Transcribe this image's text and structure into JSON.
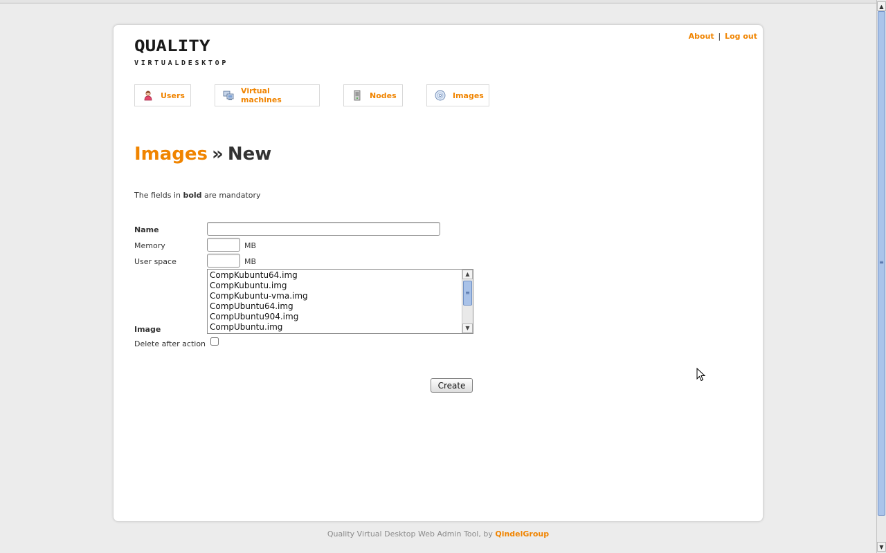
{
  "header": {
    "logo_main": "QUALITY",
    "logo_sub": "VIRTUALDESKTOP",
    "about_link": "About",
    "separator": "|",
    "logout_link": "Log out"
  },
  "nav": [
    {
      "label": "Users",
      "icon": "user-icon"
    },
    {
      "label": "Virtual machines",
      "icon": "virtual-machines-icon"
    },
    {
      "label": "Nodes",
      "icon": "server-icon"
    },
    {
      "label": "Images",
      "icon": "disc-icon"
    }
  ],
  "page": {
    "section": "Images",
    "separator": "»",
    "current": "New"
  },
  "hint": {
    "before": "The fields in ",
    "bold": "bold",
    "after": " are mandatory"
  },
  "form": {
    "name_label": "Name",
    "name_value": "",
    "memory_label": "Memory",
    "memory_value": "",
    "memory_unit": "MB",
    "user_space_label": "User space",
    "user_space_value": "",
    "user_space_unit": "MB",
    "image_label": "Image",
    "image_options": [
      "CompKubuntu64.img",
      "CompKubuntu.img",
      "CompKubuntu-vma.img",
      "CompUbuntu64.img",
      "CompUbuntu904.img",
      "CompUbuntu.img"
    ],
    "delete_label": "Delete after action",
    "delete_checked": false,
    "create_button": "Create"
  },
  "footer": {
    "text": "Quality Virtual Desktop Web Admin Tool, by ",
    "link": "QindelGroup"
  },
  "colors": {
    "accent": "#f08400",
    "text": "#333333",
    "background": "#ececec"
  }
}
